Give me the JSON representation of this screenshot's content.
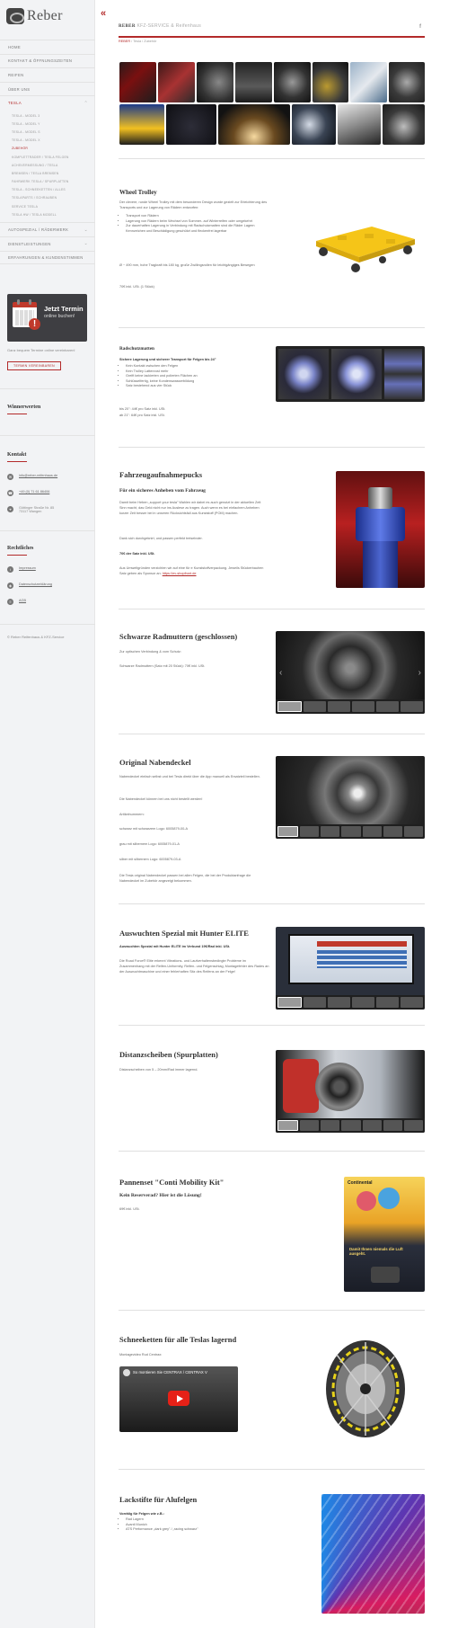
{
  "brand": {
    "name": "Reber"
  },
  "header": {
    "brand": "REBER",
    "title": "KFZ-SERVICE & Reifenhaus"
  },
  "breadcrumb": [
    "REBER",
    "Tesla",
    "Zubehör"
  ],
  "nav": [
    {
      "label": "HOME"
    },
    {
      "label": "KONTAKT & ÖFFNUNGSZEITEN"
    },
    {
      "label": "REIFEN"
    },
    {
      "label": "ÜBER UNS"
    },
    {
      "label": "TESLA",
      "active": true,
      "sub": [
        {
          "label": "TESLA - MODEL 3"
        },
        {
          "label": "TESLA - MODEL Y"
        },
        {
          "label": "TESLA - MODEL S"
        },
        {
          "label": "TESLA - MODEL X"
        },
        {
          "label": "ZUBEHÖR",
          "active": true
        },
        {
          "label": "KOMPLETTRÄDER / TESLA FELGEN"
        },
        {
          "label": "ACHSVERMESSUNG / TESLA"
        },
        {
          "label": "BREMSEN / TESLA BREMSEN"
        },
        {
          "label": "FAHRWERK TESLA / SPURPLATTEN"
        },
        {
          "label": "TESLA - SCHNEEKETTEN / ALLES"
        },
        {
          "label": "TESLAPARTS / SCHRAUBEN"
        },
        {
          "label": "SERVICE TESLA"
        },
        {
          "label": "TESLA HW / TESLA MODELL"
        }
      ]
    },
    {
      "label": "AUTOSPEZIAL / RÄDERWERK"
    },
    {
      "label": "DIENSTLEISTUNGEN"
    },
    {
      "label": "ERFAHRUNGEN & KUNDENSTIMMEN"
    }
  ],
  "booking": {
    "line1": "Jetzt Termin",
    "line2": "online buchen!",
    "note": "Ganz bequem Termine online vereinbaren!",
    "button": "TERMIN VEREINBAREN"
  },
  "sidebar": {
    "winners_title": "Winnerwerten",
    "contact_title": "Kontakt",
    "email": "info@reber-reifenhaus.de",
    "phone": "+49 (0) 71 61 86406",
    "address_1": "Göttinger Straße Nr. 85",
    "address_2": "73117 Wangen",
    "legal_title": "Rechtliches",
    "legal": [
      "Impressum",
      "Datenschutzerklärung",
      "AGB"
    ],
    "copyright": "© Reber Reifenhaus & KFZ-Service"
  },
  "sections": {
    "trolley": {
      "title": "Wheel Trolley",
      "text": "Der clevere, runde Wheel Trolley mit dem besonderen Design wurde gezielt zur Erleichterung des Transports und zur Lagerung von Rädern entworfen:",
      "bullets": [
        "Transport von Rädern",
        "Lagerung von Rädern beim Wechsel von Sommer- auf Winterreifen oder umgekehrt",
        "Zur dauerhaften Lagerung in Verbindung mit Radschutzmatten sind die Räder Lagern Kennzeichen und Beschädigung geschützt und fleckenfrei lagerbar"
      ],
      "text2": "Ø ~ 490 mm, hohe Tragkraft bis 180 kg, große Zwillingsrollen für leichtgängiges Bewegen",
      "price": "70€ inkl. USt. (1 Stück)"
    },
    "mats": {
      "title": "Radschutzmatten",
      "subtitle": "Sichere Lagerung und sicherer Transport für Felgen bis 24\"",
      "bullets": [
        "Kein Kontakt zwischen den Felgen",
        "Kein Trolley Lattenrost mehr",
        "Greift keine lackierten und polierten Flächen an",
        "Schlüsselfertig, keine Kondenswasserbildung",
        "Satz bestehend aus vier Stück"
      ],
      "price1": "bis 20\": 44€ pro Satz inkl. USt.",
      "price2": "ab 21\": 64€ pro Satz inkl. USt."
    },
    "pucks": {
      "title": "Fahrzeugaufnahmepucks",
      "subtitle": "Für ein sicheres Anheben vom Fahrzeug",
      "text": "Damit beim Heben „support your tesla\" Wahlen wir dabei es auch genutzt in der aktuellen Zeit Sinn macht, das Geld nicht nur ins Auslese zu tragen. Auch wenn es bei einfachem Anheben kurzer Zeit besser bei in unseren Rücksichtsfall aus Kunststoff (POM) machen.",
      "text2": "Dank sich durchgeknirt, und passen perfekt treiselnder.",
      "price": "70€ der Satz inkl. USt.",
      "text3": "Aus Umweltgründen verzichten wir auf eine für e Kunststoffverpackung. Jeweils Stückerbauhen Satz geben als Sponsor an:",
      "link": "https://ev-shopfront.de"
    },
    "nuts": {
      "title": "Schwarze Radmuttern (geschlossen)",
      "text": "Zur optischen Verbindung & vom Schutz:",
      "price": "Schwarze Radmuttern (Satz mit 20 Stück): 70€ inkl. USt."
    },
    "caps": {
      "title": "Original Nabendeckel",
      "lines": [
        "Nabendeckel einfach selbst und bei Tesla direkt über die App manuell als Ersatzteil bestellen.",
        "Die Nabendeckel können bei uns nicht bestellt werden!",
        "Artikelnummern:",
        "schwarz mit schwarzem Logo: 6005879-00-A",
        "grau mit silbernem Logo: 6005879-01-A",
        "silber mit silbernem Logo: 6005879-03-A",
        "Die Tesla original Nabendeckel passen bei allen Felgen, die bei der Produktanfrage die Nabendeckel im Zubehör angezeigt bekommen."
      ]
    },
    "balance": {
      "title": "Auswuchten Spezial mit Hunter ELITE",
      "subtitle": "Auswuchten Spezial mit Hunter ELITE im Verbund 19€/Rad inkl. USt.",
      "text": "Die Road Force® Elite erkennt Vibrations- und Laufverhaltensbedingte Probleme im Zusammenhang mit der Reifen-Uniformity, Reifen- und Felgenschlag, Montagefehler des Rades an der Auswuchtmaschine und einer fehlerhaften Sitz des Reifens an der Felge!"
    },
    "spacers": {
      "title": "Distanzscheiben (Spurplatten)",
      "text": "Distanzscheiben von 5 – 20mm/Rad immer lagernd."
    },
    "kit": {
      "title": "Pannenset \"Conti Mobility Kit\"",
      "subtitle": "Kein Reserverad? Hier ist die Lösung!",
      "price": "69€ inkl. USt.",
      "box_brand": "Continental",
      "box_text": "Damit Ihnen niemals die Luft ausgeht."
    },
    "chains": {
      "title": "Schneeketten für alle Teslas lagernd",
      "text": "Montagevideo Rud Centrax:",
      "video_title": "So montieren Sie CENTRAX / CENTRAX V"
    },
    "paint": {
      "title": "Lackstifte für Alufelgen",
      "subtitle": "Vorrätig für Felgen wie z.B.:",
      "bullets": [
        "Rad Lagern",
        "Avanti Munich",
        "ATS Performance „dark grey\" / „racing schwarz\""
      ]
    }
  },
  "colors": {
    "accent": "#b32a2a",
    "sidebar_bg": "#f2f3f5",
    "text": "#555555"
  }
}
